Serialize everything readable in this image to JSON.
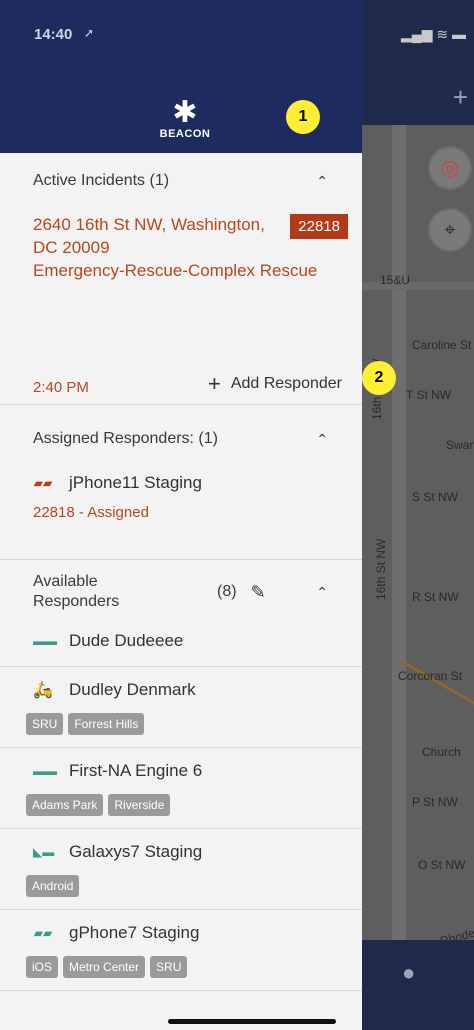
{
  "status_time": "14:40",
  "app": {
    "logo_text": "BEACON"
  },
  "annotations": {
    "one": "1",
    "two": "2"
  },
  "incidents": {
    "header": "Active Incidents (1)",
    "address": "2640 16th St NW, Washington, DC 20009",
    "type": "Emergency-Rescue-Complex Rescue",
    "code": "22818",
    "time": "2:40 PM",
    "add_responder": "Add Responder"
  },
  "assigned": {
    "header": "Assigned Responders: (1)",
    "name": "jPhone11 Staging",
    "sub": "22818 - Assigned"
  },
  "available": {
    "header": "Available Responders",
    "count": "(8)",
    "items": [
      {
        "name": "Dude Dudeeee",
        "tags": []
      },
      {
        "name": "Dudley Denmark",
        "tags": [
          "SRU",
          "Forrest Hills"
        ]
      },
      {
        "name": "First-NA Engine 6",
        "tags": [
          "Adams Park",
          "Riverside"
        ]
      },
      {
        "name": "Galaxys7 Staging",
        "tags": [
          "Android"
        ]
      },
      {
        "name": "gPhone7 Staging",
        "tags": [
          "iOS",
          "Metro Center",
          "SRU"
        ]
      }
    ]
  },
  "map": {
    "streets": [
      "15&U",
      "Caroline St",
      "T St NW",
      "Swann S",
      "S St NW",
      "16th St NW",
      "16th St NW",
      "R St NW",
      "Corcoran St",
      "Church",
      "P St NW",
      "O St NW",
      "Rhode"
    ]
  },
  "colors": {
    "header_bg": "#1d2b5e",
    "accent": "#b8461f",
    "badge": "#ffee33"
  }
}
